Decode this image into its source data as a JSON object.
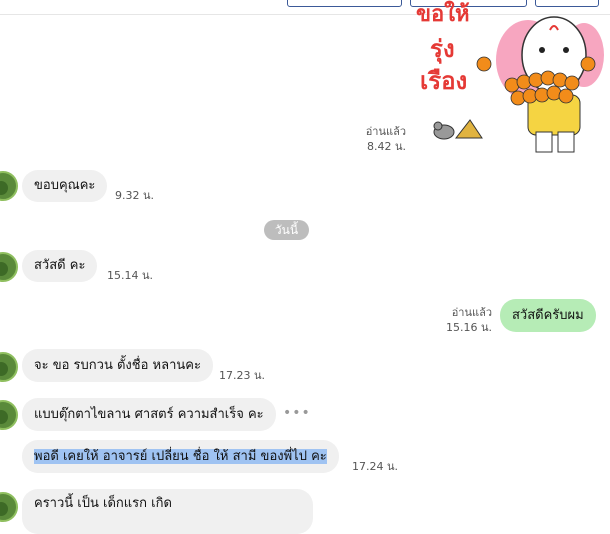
{
  "sticker": {
    "line1": "ขอให้",
    "line2": "รุ่ง",
    "line3": "เรือง",
    "text_color": "#e53935"
  },
  "messages": [
    {
      "id": "m1",
      "side": "out",
      "type": "sticker",
      "read": "อ่านแล้ว",
      "time": "8.42 น."
    },
    {
      "id": "m2",
      "side": "in",
      "text": "ขอบคุณคะ",
      "time": "9.32 น."
    },
    {
      "id": "day",
      "label": "วันนี้"
    },
    {
      "id": "m3",
      "side": "in",
      "text": "สวัสดี คะ",
      "time": "15.14 น."
    },
    {
      "id": "m4",
      "side": "out",
      "text": "สวัสดีครับผม",
      "read": "อ่านแล้ว",
      "time": "15.16 น."
    },
    {
      "id": "m5",
      "side": "in",
      "text": "จะ ขอ รบกวน ตั้งชื่อ หลานคะ",
      "time": "17.23 น."
    },
    {
      "id": "m6",
      "side": "in",
      "text": "แบบตุ๊กตาไขลาน ศาสตร์ ความสำเร็จ คะ"
    },
    {
      "id": "m7",
      "side": "in",
      "text": "พอดี เคยให้ อาจารย์ เปลี่ยน ชื่อ ให้ สามี ของพี่ไป คะ",
      "time": "17.24 น."
    },
    {
      "id": "m8",
      "side": "in",
      "text": "คราวนี้ เป็น เด็กแรก เกิด"
    }
  ],
  "more_label": "•••",
  "colors": {
    "outgoing_bubble": "#b6ecb6",
    "incoming_bubble": "#f0f0f0",
    "highlight": "#9fc3f2"
  }
}
